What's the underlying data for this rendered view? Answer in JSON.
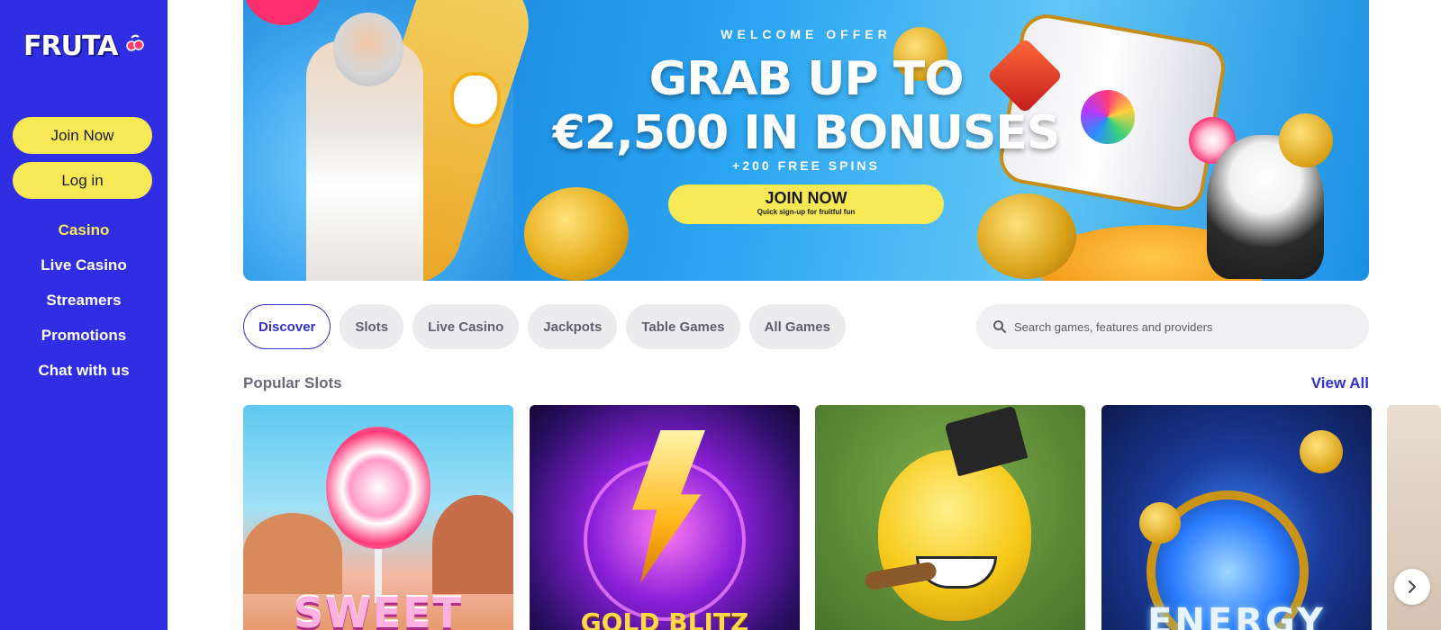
{
  "brand": {
    "logo_text": "FRUTA"
  },
  "sidebar": {
    "join_label": "Join Now",
    "login_label": "Log in",
    "nav": [
      {
        "label": "Casino",
        "active": true
      },
      {
        "label": "Live Casino",
        "active": false
      },
      {
        "label": "Streamers",
        "active": false
      },
      {
        "label": "Promotions",
        "active": false
      },
      {
        "label": "Chat with us",
        "active": false
      }
    ]
  },
  "hero": {
    "kicker": "WELCOME OFFER",
    "title_line1": "GRAB UP TO",
    "title_line2": "€2,500 IN BONUSES",
    "subtitle": "+200 FREE SPINS",
    "cta_label": "JOIN NOW",
    "cta_note": "Quick sign-up for fruitful fun"
  },
  "tabs": [
    {
      "label": "Discover",
      "active": true
    },
    {
      "label": "Slots",
      "active": false
    },
    {
      "label": "Live Casino",
      "active": false
    },
    {
      "label": "Jackpots",
      "active": false
    },
    {
      "label": "Table Games",
      "active": false
    },
    {
      "label": "All Games",
      "active": false
    }
  ],
  "search": {
    "placeholder": "Search games, features and providers"
  },
  "popular": {
    "title": "Popular Slots",
    "view_all": "View All",
    "games": [
      {
        "title": "SWEET"
      },
      {
        "title": "GOLD BLITZ"
      },
      {
        "title": ""
      },
      {
        "title": "ENERGY"
      }
    ]
  },
  "colors": {
    "sidebar_bg": "#2f2ee2",
    "accent_yellow": "#f7e956",
    "accent_blue": "#3430d2"
  },
  "icons": {
    "search": "search-icon",
    "next": "chevron-right-icon",
    "logo_cherry": "cherry-icon"
  }
}
